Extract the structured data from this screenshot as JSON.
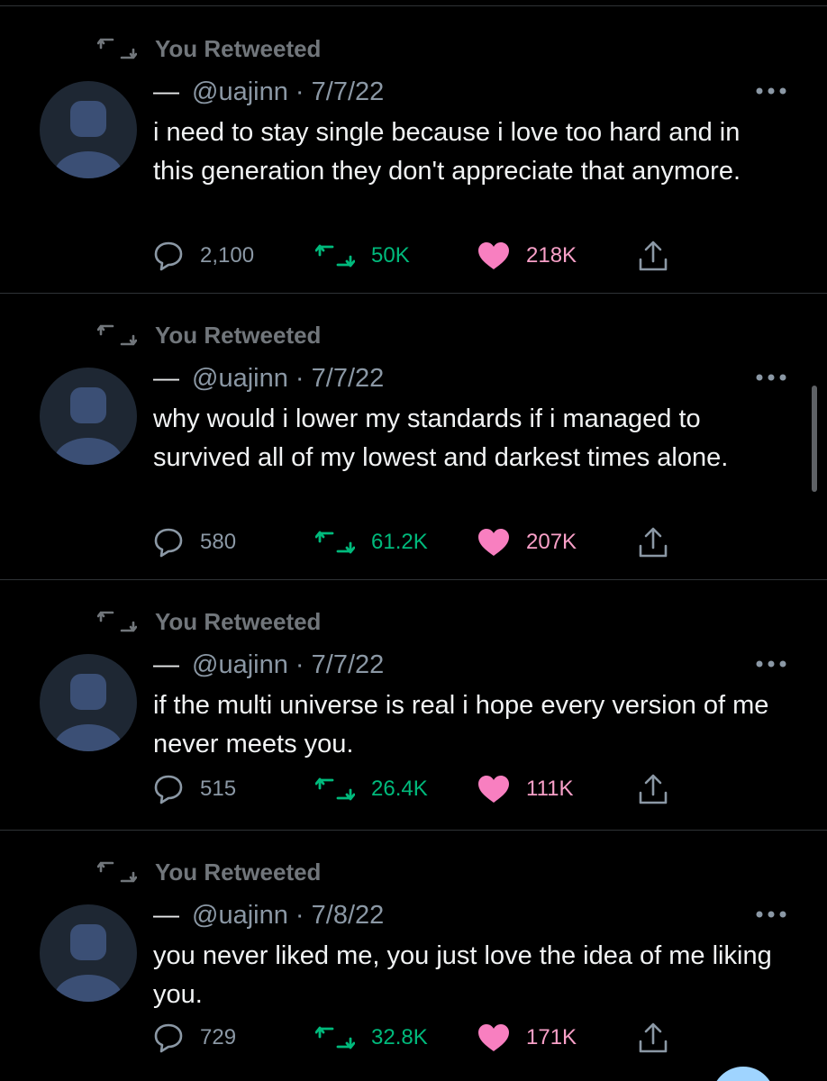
{
  "colors": {
    "background": "#000000",
    "divider": "#2f3336",
    "secondary_text": "#8b98a5",
    "retweet_green": "#00ba7c",
    "like_pink": "#f91880",
    "avatar_bg": "#1e2733",
    "avatar_fg": "#3b4f75"
  },
  "icons": {
    "retweet": "retweet-icon",
    "reply": "reply-bubble-icon",
    "like": "heart-icon",
    "share": "share-upload-icon",
    "more": "more-dots-icon"
  },
  "tweets": [
    {
      "retweet_label": "You Retweeted",
      "dash": "—",
      "handle": "@uajinn",
      "sep": "·",
      "date": "7/7/22",
      "text": "i need to stay single because i love too hard and in this generation they don't appreciate that anymore.",
      "replies": "2,100",
      "retweets": "50K",
      "likes": "218K"
    },
    {
      "retweet_label": "You Retweeted",
      "dash": "—",
      "handle": "@uajinn",
      "sep": "·",
      "date": "7/7/22",
      "text": "why would i lower my standards if i managed to survived all of my lowest and darkest times alone.",
      "replies": "580",
      "retweets": "61.2K",
      "likes": "207K"
    },
    {
      "retweet_label": "You Retweeted",
      "dash": "—",
      "handle": "@uajinn",
      "sep": "·",
      "date": "7/7/22",
      "text": "if the multi universe is real i hope every version of me never meets you.",
      "replies": "515",
      "retweets": "26.4K",
      "likes": "111K"
    },
    {
      "retweet_label": "You Retweeted",
      "dash": "—",
      "handle": "@uajinn",
      "sep": "·",
      "date": "7/8/22",
      "text": "you never liked me, you just love the idea of me liking you.",
      "replies": "729",
      "retweets": "32.8K",
      "likes": "171K"
    }
  ]
}
